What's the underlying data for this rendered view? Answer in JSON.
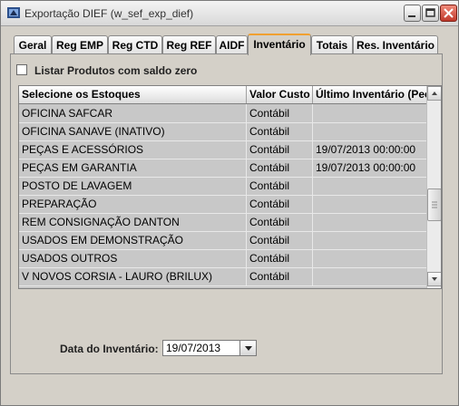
{
  "window": {
    "title": "Exportação DIEF (w_sef_exp_dief)"
  },
  "tabs": [
    {
      "label": "Geral"
    },
    {
      "label": "Reg EMP"
    },
    {
      "label": "Reg CTD"
    },
    {
      "label": "Reg REF"
    },
    {
      "label": "AIDF"
    },
    {
      "label": "Inventário"
    },
    {
      "label": "Totais"
    },
    {
      "label": "Res. Inventário"
    }
  ],
  "active_tab": "Inventário",
  "checkbox": {
    "label": "Listar Produtos com saldo zero",
    "checked": false
  },
  "grid": {
    "headers": [
      "Selecione os Estoques",
      "Valor Custo",
      "Último Inventário (Peç"
    ],
    "rows": [
      [
        "OFICINA SAFCAR",
        "Contábil",
        ""
      ],
      [
        "OFICINA SANAVE (INATIVO)",
        "Contábil",
        ""
      ],
      [
        "PEÇAS E ACESSÓRIOS",
        "Contábil",
        "19/07/2013 00:00:00"
      ],
      [
        "PEÇAS EM GARANTIA",
        "Contábil",
        "19/07/2013 00:00:00"
      ],
      [
        "POSTO DE LAVAGEM",
        "Contábil",
        ""
      ],
      [
        "PREPARAÇÃO",
        "Contábil",
        ""
      ],
      [
        "REM CONSIGNAÇÃO DANTON",
        "Contábil",
        ""
      ],
      [
        "USADOS EM DEMONSTRAÇÃO",
        "Contábil",
        ""
      ],
      [
        "USADOS OUTROS",
        "Contábil",
        ""
      ],
      [
        "V NOVOS CORSIA - LAURO (BRILUX)",
        "Contábil",
        ""
      ]
    ]
  },
  "date": {
    "label": "Data do Inventário:",
    "value": "19/07/2013"
  },
  "icons": {
    "app": "app-icon",
    "minimize": "minimize-icon",
    "maximize": "maximize-icon",
    "close": "close-icon",
    "scroll_up": "arrow-up-icon",
    "scroll_down": "arrow-down-icon",
    "dropdown": "chevron-down-icon"
  },
  "colors": {
    "active_tab_accent": "#f0a030",
    "close_button": "#c0392b"
  }
}
